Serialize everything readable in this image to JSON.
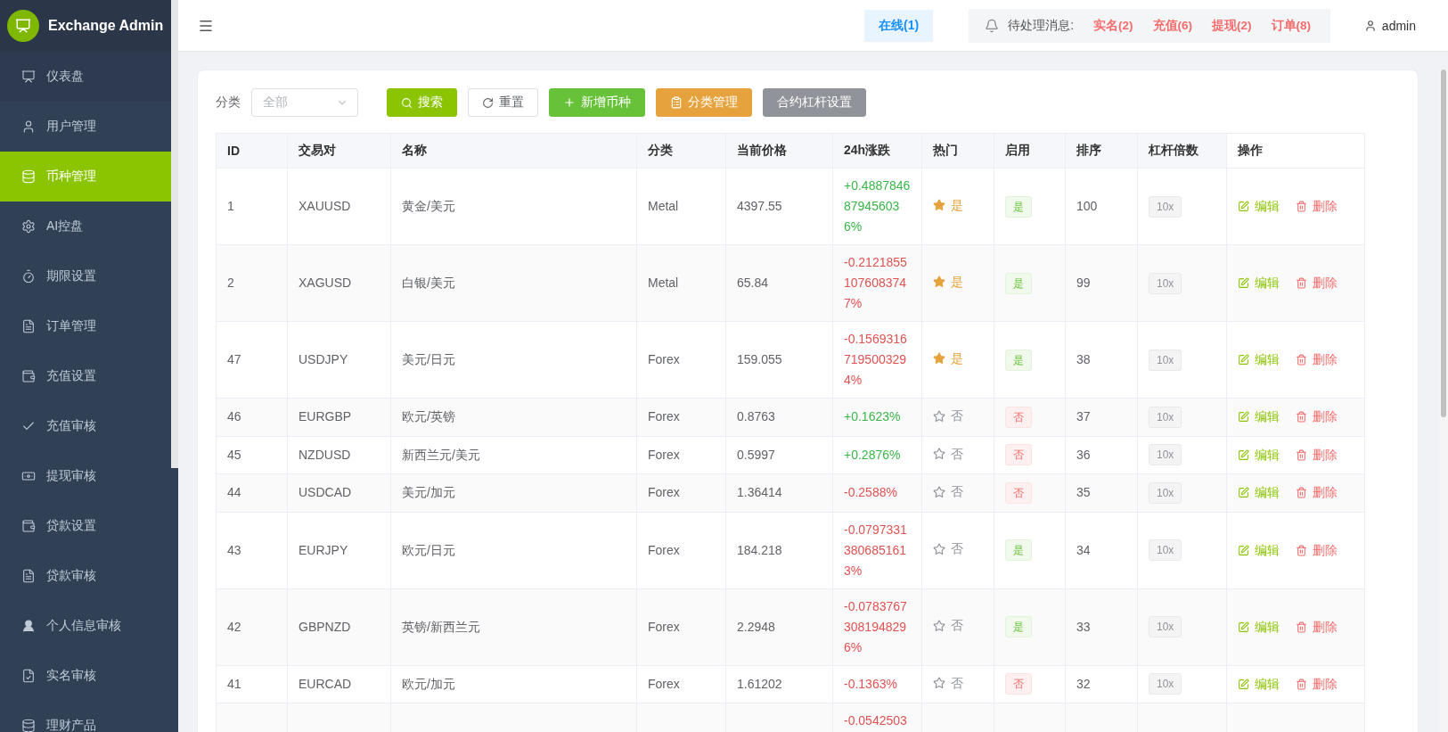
{
  "sidebar": {
    "title": "Exchange Admin",
    "items": [
      {
        "label": "仪表盘",
        "selected": false
      },
      {
        "label": "用户管理",
        "selected": false
      },
      {
        "label": "币种管理",
        "selected": true
      },
      {
        "label": "AI控盘",
        "selected": false
      },
      {
        "label": "期限设置",
        "selected": false
      },
      {
        "label": "订单管理",
        "selected": false
      },
      {
        "label": "充值设置",
        "selected": false
      },
      {
        "label": "充值审核",
        "selected": false
      },
      {
        "label": "提现审核",
        "selected": false
      },
      {
        "label": "贷款设置",
        "selected": false
      },
      {
        "label": "贷款审核",
        "selected": false
      },
      {
        "label": "个人信息审核",
        "selected": false
      },
      {
        "label": "实名审核",
        "selected": false
      },
      {
        "label": "理财产品",
        "selected": false
      }
    ]
  },
  "header": {
    "online": "在线(1)",
    "pending_label": "待处理消息:",
    "pending": [
      "实名(2)",
      "充值(6)",
      "提现(2)",
      "订单(8)"
    ],
    "user": "admin"
  },
  "filter": {
    "label": "分类",
    "placeholder": "全部"
  },
  "buttons": [
    {
      "label": "搜索",
      "kind": "search"
    },
    {
      "label": "重置",
      "kind": "reset"
    },
    {
      "label": "新增币种",
      "kind": "add"
    },
    {
      "label": "分类管理",
      "kind": "category"
    },
    {
      "label": "合约杠杆设置",
      "kind": "leverage"
    }
  ],
  "table": {
    "columns": [
      "ID",
      "交易对",
      "名称",
      "分类",
      "当前价格",
      "24h涨跌",
      "热门",
      "启用",
      "排序",
      "杠杆倍数",
      "操作"
    ],
    "rows": [
      {
        "id": "1",
        "pair": "XAUUSD",
        "name": "黄金/美元",
        "category": "Metal",
        "price": "4397.55",
        "change": "+0.4887846879456036%",
        "hot": true,
        "hot_label": "是",
        "enabled": true,
        "enabled_label": "是",
        "sort": "100",
        "leverage": "10x",
        "edit": "编辑",
        "delete": "删除"
      },
      {
        "id": "2",
        "pair": "XAGUSD",
        "name": "白银/美元",
        "category": "Metal",
        "price": "65.84",
        "change": "-0.21218551076083747%",
        "hot": true,
        "hot_label": "是",
        "enabled": true,
        "enabled_label": "是",
        "sort": "99",
        "leverage": "10x",
        "edit": "编辑",
        "delete": "删除"
      },
      {
        "id": "47",
        "pair": "USDJPY",
        "name": "美元/日元",
        "category": "Forex",
        "price": "159.055",
        "change": "-0.15693167195003294%",
        "hot": true,
        "hot_label": "是",
        "enabled": true,
        "enabled_label": "是",
        "sort": "38",
        "leverage": "10x",
        "edit": "编辑",
        "delete": "删除"
      },
      {
        "id": "46",
        "pair": "EURGBP",
        "name": "欧元/英镑",
        "category": "Forex",
        "price": "0.8763",
        "change": "+0.1623%",
        "hot": false,
        "hot_label": "否",
        "enabled": false,
        "enabled_label": "否",
        "sort": "37",
        "leverage": "10x",
        "edit": "编辑",
        "delete": "删除"
      },
      {
        "id": "45",
        "pair": "NZDUSD",
        "name": "新西兰元/美元",
        "category": "Forex",
        "price": "0.5997",
        "change": "+0.2876%",
        "hot": false,
        "hot_label": "否",
        "enabled": false,
        "enabled_label": "否",
        "sort": "36",
        "leverage": "10x",
        "edit": "编辑",
        "delete": "删除"
      },
      {
        "id": "44",
        "pair": "USDCAD",
        "name": "美元/加元",
        "category": "Forex",
        "price": "1.36414",
        "change": "-0.2588%",
        "hot": false,
        "hot_label": "否",
        "enabled": false,
        "enabled_label": "否",
        "sort": "35",
        "leverage": "10x",
        "edit": "编辑",
        "delete": "删除"
      },
      {
        "id": "43",
        "pair": "EURJPY",
        "name": "欧元/日元",
        "category": "Forex",
        "price": "184.218",
        "change": "-0.07973313806851613%",
        "hot": false,
        "hot_label": "否",
        "enabled": true,
        "enabled_label": "是",
        "sort": "34",
        "leverage": "10x",
        "edit": "编辑",
        "delete": "删除"
      },
      {
        "id": "42",
        "pair": "GBPNZD",
        "name": "英镑/新西兰元",
        "category": "Forex",
        "price": "2.2948",
        "change": "-0.07837673081948296%",
        "hot": false,
        "hot_label": "否",
        "enabled": true,
        "enabled_label": "是",
        "sort": "33",
        "leverage": "10x",
        "edit": "编辑",
        "delete": "删除"
      },
      {
        "id": "41",
        "pair": "EURCAD",
        "name": "欧元/加元",
        "category": "Forex",
        "price": "1.61202",
        "change": "-0.1363%",
        "hot": false,
        "hot_label": "否",
        "enabled": false,
        "enabled_label": "否",
        "sort": "32",
        "leverage": "10x",
        "edit": "编辑",
        "delete": "删除"
      },
      {
        "change": "-0.0542503"
      }
    ]
  }
}
